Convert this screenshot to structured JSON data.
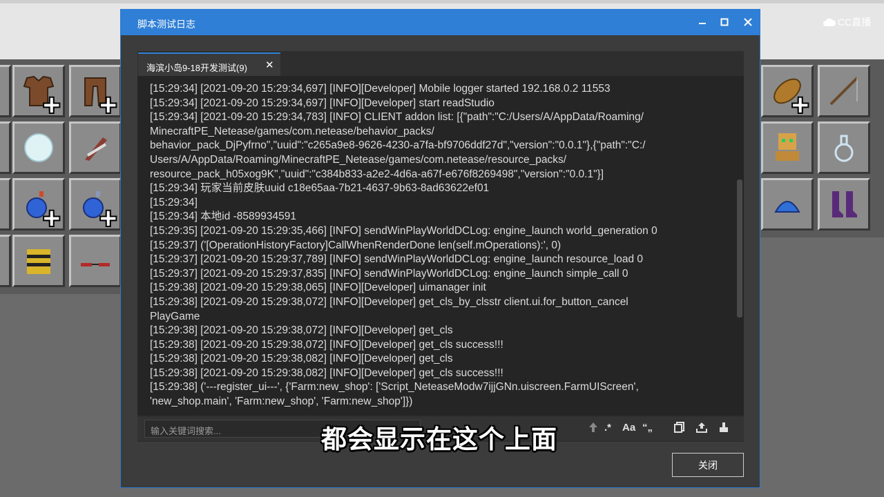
{
  "brand": {
    "logo_text": "CC直播"
  },
  "dialog": {
    "title": "脚本测试日志",
    "tab_label": "海滨小岛9-18开发测试(9)",
    "search_placeholder": "输入关键词搜索...",
    "tools": {
      "regex": ".*",
      "match_case": "Aa",
      "quote": "“„"
    },
    "close_button": "关闭",
    "log_lines": [
      "[15:29:34] [2021-09-20 15:29:34,697] [INFO][Developer] Mobile logger started 192.168.0.2 11553",
      "[15:29:34] [2021-09-20 15:29:34,697] [INFO][Developer] start readStudio",
      "[15:29:34] [2021-09-20 15:29:34,783] [INFO] CLIENT addon list: [{\"path\":\"C:/Users/A/AppData/Roaming/",
      "MinecraftPE_Netease/games/com.netease/behavior_packs/",
      "behavior_pack_DjPyfrno\",\"uuid\":\"c265a9e8-9626-4230-a7fa-bf9706ddf27d\",\"version\":\"0.0.1\"},{\"path\":\"C:/",
      "Users/A/AppData/Roaming/MinecraftPE_Netease/games/com.netease/resource_packs/",
      "resource_pack_h05xog9K\",\"uuid\":\"c384b833-a2e2-4d6a-a67f-e676f8269498\",\"version\":\"0.0.1\"}]",
      "[15:29:34] 玩家当前皮肤uuid c18e65aa-7b21-4637-9b63-8ad63622ef01",
      "[15:29:34]",
      "[15:29:34] 本地id -8589934591",
      "[15:29:35] [2021-09-20 15:29:35,466] [INFO] sendWinPlayWorldDCLog: engine_launch world_generation 0",
      "[15:29:37] ('[OperationHistoryFactory]CallWhenRenderDone len(self.mOperations):', 0)",
      "[15:29:37] [2021-09-20 15:29:37,789] [INFO] sendWinPlayWorldDCLog: engine_launch resource_load 0",
      "[15:29:37] [2021-09-20 15:29:37,835] [INFO] sendWinPlayWorldDCLog: engine_launch simple_call 0",
      "[15:29:38] [2021-09-20 15:29:38,065] [INFO][Developer] uimanager init",
      "[15:29:38] [2021-09-20 15:29:38,072] [INFO][Developer] get_cls_by_clsstr client.ui.for_button_cancel",
      "PlayGame",
      "[15:29:38] [2021-09-20 15:29:38,072] [INFO][Developer] get_cls",
      "[15:29:38] [2021-09-20 15:29:38,072] [INFO][Developer] get_cls success!!!",
      "[15:29:38] [2021-09-20 15:29:38,082] [INFO][Developer] get_cls",
      "[15:29:38] [2021-09-20 15:29:38,082] [INFO][Developer] get_cls success!!!",
      "[15:29:38] ('---register_ui---', {'Farm:new_shop': ['Script_NeteaseModw7ijjGNn.uiscreen.FarmUIScreen',",
      "'new_shop.main', 'Farm:new_shop', 'Farm:new_shop']})"
    ]
  },
  "subtitle": "都会显示在这个上面"
}
